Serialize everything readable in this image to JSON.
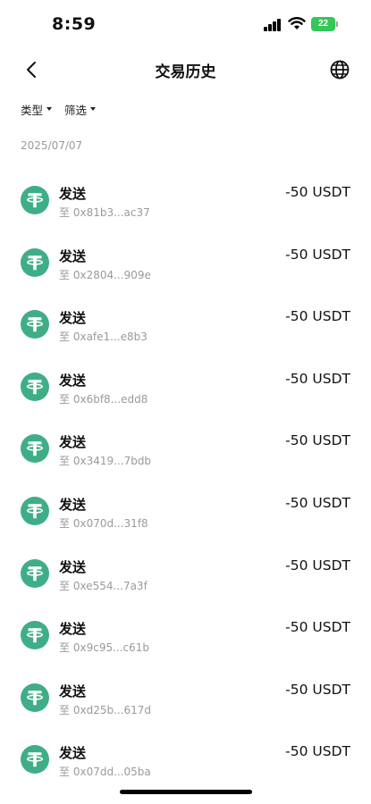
{
  "status": {
    "time": "8:59",
    "battery": "22"
  },
  "header": {
    "title": "交易历史"
  },
  "filters": {
    "type_label": "类型",
    "filter_label": "筛选"
  },
  "date_group": "2025/07/07",
  "colors": {
    "tether_green": "#3fae87",
    "muted_text": "#9a9a9a",
    "battery_green": "#34c759"
  },
  "icons": {
    "back": "chevron-left-icon",
    "language": "globe-icon",
    "token": "tether-usdt-icon"
  },
  "transactions": [
    {
      "type": "发送",
      "to_prefix": "至",
      "address": "0x81b3...ac37",
      "amount": "-50 USDT"
    },
    {
      "type": "发送",
      "to_prefix": "至",
      "address": "0x2804...909e",
      "amount": "-50 USDT"
    },
    {
      "type": "发送",
      "to_prefix": "至",
      "address": "0xafe1...e8b3",
      "amount": "-50 USDT"
    },
    {
      "type": "发送",
      "to_prefix": "至",
      "address": "0x6bf8...edd8",
      "amount": "-50 USDT"
    },
    {
      "type": "发送",
      "to_prefix": "至",
      "address": "0x3419...7bdb",
      "amount": "-50 USDT"
    },
    {
      "type": "发送",
      "to_prefix": "至",
      "address": "0x070d...31f8",
      "amount": "-50 USDT"
    },
    {
      "type": "发送",
      "to_prefix": "至",
      "address": "0xe554...7a3f",
      "amount": "-50 USDT"
    },
    {
      "type": "发送",
      "to_prefix": "至",
      "address": "0x9c95...c61b",
      "amount": "-50 USDT"
    },
    {
      "type": "发送",
      "to_prefix": "至",
      "address": "0xd25b...617d",
      "amount": "-50 USDT"
    },
    {
      "type": "发送",
      "to_prefix": "至",
      "address": "0x07dd...05ba",
      "amount": "-50 USDT"
    }
  ]
}
